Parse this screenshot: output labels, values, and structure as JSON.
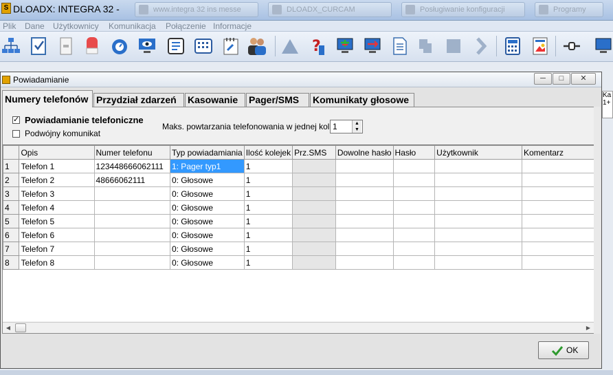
{
  "app": {
    "title": "DLOADX: INTEGRA 32 -",
    "taskbar": [
      {
        "label": "www.integra 32 ins messe",
        "icon": "window-icon"
      },
      {
        "label": "DLOADX_CURCAM",
        "icon": "window-icon"
      },
      {
        "label": "Posługiwanie konfiguracji",
        "icon": "window-icon"
      },
      {
        "label": "Programy",
        "icon": "window-icon"
      }
    ]
  },
  "menu": [
    "Plik",
    "Dane",
    "Użytkownicy",
    "Komunikacja",
    "Połączenie",
    "Informacje"
  ],
  "toolbar": [
    "structure-icon",
    "checklist-icon",
    "module-icon",
    "siren-icon",
    "timer-icon",
    "monitor-eye-icon",
    "phone-card-icon",
    "keypad-icon",
    "settings-doc-icon",
    "users-icon",
    "triangle-icon",
    "help-icon",
    "monitor-down-icon",
    "monitor-send-icon",
    "document-icon",
    "puzzle-icon",
    "square-icon",
    "arrow-icon",
    "calculator-icon",
    "image-icon",
    "connect-icon",
    "monitor-icon"
  ],
  "dialog": {
    "title": "Powiadamianie",
    "tabs": [
      "Numery telefonów",
      "Przydział zdarzeń",
      "Kasowanie",
      "Pager/SMS",
      "Komunikaty głosowe"
    ],
    "options": {
      "phone_notify_label": "Powiadamianie telefoniczne",
      "phone_notify_checked": true,
      "double_msg_label": "Podwójny komunikat",
      "double_msg_checked": false,
      "max_repeat_label": "Maks. powtarzania telefonowania w jednej kolejce:",
      "max_repeat_value": "1"
    },
    "grid": {
      "columns": [
        "Opis",
        "Numer telefonu",
        "Typ powiadamiania",
        "Ilość kolejek",
        "Prz.SMS",
        "Dowolne hasło",
        "Hasło",
        "Użytkownik",
        "Komentarz"
      ],
      "rows": [
        {
          "n": "1",
          "opis": "Telefon  1",
          "numer": "123448666062111",
          "typ": "1: Pager typ1",
          "ilosc": "1"
        },
        {
          "n": "2",
          "opis": "Telefon  2",
          "numer": "48666062111",
          "typ": "0: Głosowe",
          "ilosc": "1"
        },
        {
          "n": "3",
          "opis": "Telefon  3",
          "numer": "",
          "typ": "0: Głosowe",
          "ilosc": "1"
        },
        {
          "n": "4",
          "opis": "Telefon  4",
          "numer": "",
          "typ": "0: Głosowe",
          "ilosc": "1"
        },
        {
          "n": "5",
          "opis": "Telefon  5",
          "numer": "",
          "typ": "0: Głosowe",
          "ilosc": "1"
        },
        {
          "n": "6",
          "opis": "Telefon  6",
          "numer": "",
          "typ": "0: Głosowe",
          "ilosc": "1"
        },
        {
          "n": "7",
          "opis": "Telefon  7",
          "numer": "",
          "typ": "0: Głosowe",
          "ilosc": "1"
        },
        {
          "n": "8",
          "opis": "Telefon  8",
          "numer": "",
          "typ": "0: Głosowe",
          "ilosc": "1"
        }
      ],
      "selected_row": 1
    },
    "ok_label": "OK"
  },
  "right_panel_text": "Ka 1+",
  "colors": {
    "selection": "#3399ff",
    "ok_check": "#2e9a2e"
  }
}
